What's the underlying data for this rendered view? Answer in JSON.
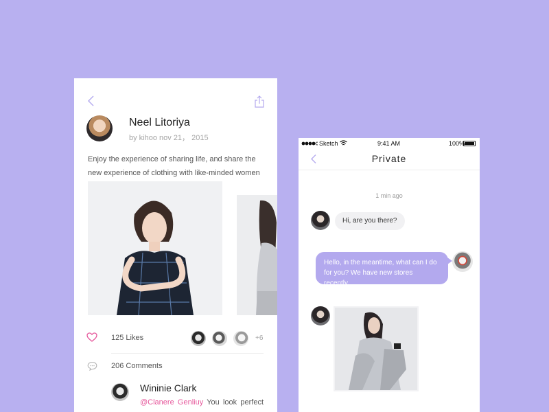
{
  "post": {
    "author_name": "Neel Litoriya",
    "author_meta": "by kihoo nov 21， 2015",
    "text": "Enjoy the experience of sharing life, and share the new experience of clothing with like-minded women",
    "likes_label": "125 Likes",
    "likes_more": "+6",
    "comments_label": "206 Comments",
    "comment": {
      "author": "Wininie Clark",
      "mention": "@Clanere Genliuy",
      "text": " You look perfect in"
    }
  },
  "chat": {
    "status": {
      "carrier": "Sketch",
      "time": "9:41 AM",
      "battery": "100%"
    },
    "title": "Private",
    "timestamp": "1 min ago",
    "messages": {
      "incoming_1": "Hi, are you there?",
      "outgoing_1": "Hello, in the meantime, what can I do for you? We have new stores recently."
    }
  },
  "colors": {
    "background": "#b8b0f0",
    "accent_purple": "#b3a9ee",
    "heart_pink": "#e6579b",
    "mention_pink": "#e6579b"
  },
  "icons": {
    "back": "chevron-left-icon",
    "share": "share-icon",
    "like": "heart-icon",
    "comment": "comment-icon",
    "wifi": "wifi-icon",
    "battery": "battery-icon"
  }
}
